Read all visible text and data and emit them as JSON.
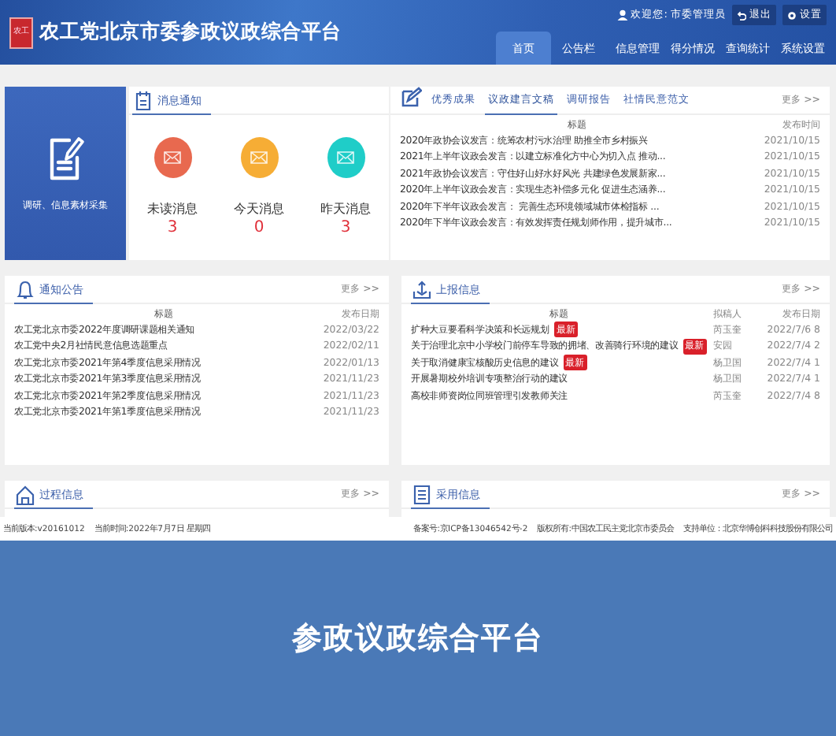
{
  "header": {
    "logo": "农工",
    "title": "农工党北京市委参政议政综合平台",
    "user": "欢迎您: 市委管理员",
    "actions": [
      {
        "label": "退出",
        "kind": "logout"
      },
      {
        "label": "设置",
        "kind": "settings"
      }
    ],
    "nav": [
      {
        "label": "首页",
        "selected": true
      },
      {
        "label": "公告栏",
        "selected": false
      },
      {
        "label": "信息管理",
        "selected": false
      },
      {
        "label": "得分情况",
        "selected": false
      },
      {
        "label": "查询统计",
        "selected": false
      },
      {
        "label": "系统设置",
        "selected": false
      }
    ]
  },
  "tile": {
    "label": "调研、信息素材采集"
  },
  "messages": {
    "title": "消息通知",
    "items": [
      {
        "label": "未读消息",
        "count": "3",
        "color": "#e8694f"
      },
      {
        "label": "今天消息",
        "count": "0",
        "color": "#f6ad35"
      },
      {
        "label": "昨天消息",
        "count": "3",
        "color": "#1fcdc8"
      }
    ]
  },
  "achievements": {
    "tabs": [
      {
        "label": "优秀成果",
        "selected": false
      },
      {
        "label": "议政建言文稿",
        "selected": true
      },
      {
        "label": "调研报告",
        "selected": false
      },
      {
        "label": "社情民意范文",
        "selected": false
      }
    ],
    "more": "更多 >>",
    "columns": [
      "标题",
      "发布时间"
    ],
    "rows": [
      {
        "title": "2020年政协会议发言：统筹农村污水治理 助推全市乡村振兴",
        "date": "2021/10/15"
      },
      {
        "title": "2021年上半年议政会发言：以建立标准化方中心为切入点 推动...",
        "date": "2021/10/15"
      },
      {
        "title": "2021年政协会议发言：守住好山好水好风光 共建绿色发展新家...",
        "date": "2021/10/15"
      },
      {
        "title": "2020年上半年议政会发言：实现生态补偿多元化 促进生态涵养...",
        "date": "2021/10/15"
      },
      {
        "title": "2020年下半年议政会发言： 完善生态环境领域城市体检指标 ...",
        "date": "2021/10/15"
      },
      {
        "title": "2020年下半年议政会发言：有效发挥责任规划师作用，提升城市...",
        "date": "2021/10/15"
      }
    ]
  },
  "notices": {
    "title": "通知公告",
    "more": "更多 >>",
    "columns": [
      "标题",
      "发布日期"
    ],
    "rows": [
      {
        "title": "农工党北京市委2022年度调研课题相关通知",
        "date": "2022/03/22"
      },
      {
        "title": "农工党中央2月社情民意信息选题重点",
        "date": "2022/02/11"
      },
      {
        "title": "农工党北京市委2021年第4季度信息采用情况",
        "date": "2022/01/13"
      },
      {
        "title": "农工党北京市委2021年第3季度信息采用情况",
        "date": "2021/11/23"
      },
      {
        "title": "农工党北京市委2021年第2季度信息采用情况",
        "date": "2021/11/23"
      },
      {
        "title": "农工党北京市委2021年第1季度信息采用情况",
        "date": "2021/11/23"
      }
    ]
  },
  "reports": {
    "title": "上报信息",
    "more": "更多 >>",
    "columns": [
      "标题",
      "拟稿人",
      "发布日期"
    ],
    "rows": [
      {
        "title": "扩种大豆要看科学决策和长远规划",
        "badge": "最新",
        "author": "芮玉奎",
        "date": "2022/7/6 8"
      },
      {
        "title": "关于治理北京中小学校门前停车导致的拥堵、改善骑行环境的建议",
        "badge": "最新",
        "author": "安园",
        "date": "2022/7/4 2"
      },
      {
        "title": "关于取消健康宝核酸历史信息的建议",
        "badge": "最新",
        "author": "杨卫国",
        "date": "2022/7/4 1"
      },
      {
        "title": "开展暑期校外培训专项整治行动的建议",
        "author": "杨卫国",
        "date": "2022/7/4 1"
      },
      {
        "title": "高校非师资岗位同班管理引发教师关注",
        "author": "芮玉奎",
        "date": "2022/7/4 8"
      }
    ]
  },
  "process": {
    "title": "过程信息",
    "more": "更多 >>"
  },
  "adopted": {
    "title": "采用信息",
    "more": "更多 >>"
  },
  "footer": {
    "left": [
      "当前版本:v20161012",
      "当前时间:2022年7月7日 星期四"
    ],
    "right": [
      "备案号:京ICP备13046542号-2",
      "版权所有:中国农工民主党北京市委员会",
      "支持单位：北京华博创科科技股份有限公司"
    ]
  },
  "banner": {
    "title": "参政议政综合平台"
  }
}
